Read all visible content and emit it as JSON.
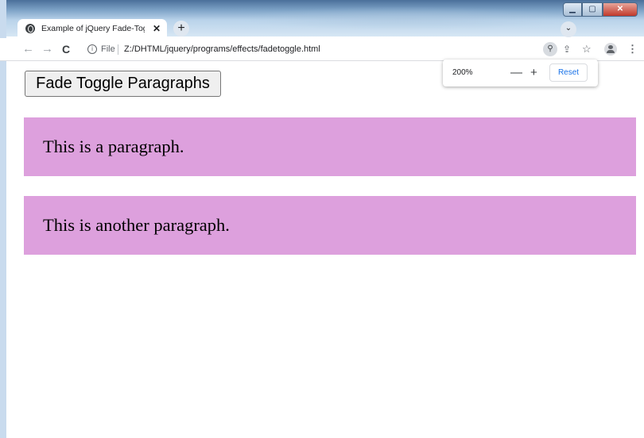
{
  "browser": {
    "tab_title": "Example of jQuery Fade-Toggle E",
    "file_label": "File",
    "url": "Z:/DHTML/jquery/programs/effects/fadetoggle.html"
  },
  "zoom_popup": {
    "level": "200%",
    "reset_label": "Reset"
  },
  "page": {
    "button_label": "Fade Toggle Paragraphs",
    "paragraphs": [
      "This is a paragraph.",
      "This is another paragraph."
    ]
  },
  "colors": {
    "paragraph_bg": "#dda0dd"
  }
}
